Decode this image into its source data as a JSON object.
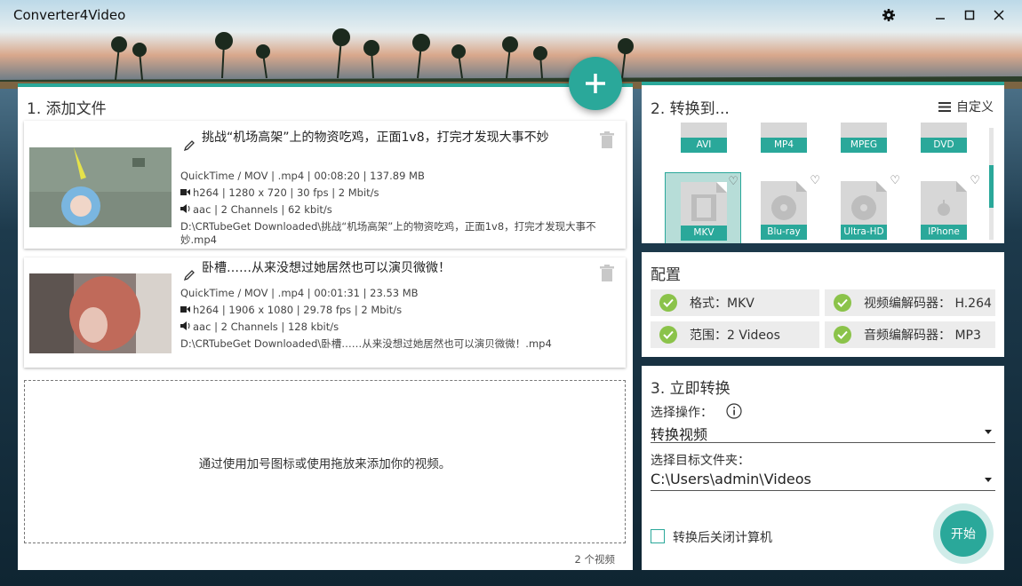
{
  "app": {
    "title": "Converter4Video"
  },
  "left": {
    "title": "1. 添加文件",
    "files": [
      {
        "name": "挑战“机场高架”上的物资吃鸡，正面1v8，打完才发现大事不妙",
        "container": "QuickTime / MOV | .mp4 | 00:08:20 | 137.89 MB",
        "video": "h264 | 1280 x 720 | 30 fps | 2 Mbit/s",
        "audio": "aac | 2 Channels | 62 kbit/s",
        "path": "D:\\CRTubeGet Downloaded\\挑战“机场高架”上的物资吃鸡，正面1v8，打完才发现大事不妙.mp4"
      },
      {
        "name": "卧槽……从来没想过她居然也可以演贝微微！",
        "container": "QuickTime / MOV | .mp4 | 00:01:31 | 23.53 MB",
        "video": "h264 | 1906 x 1080 | 29.78 fps | 2 Mbit/s",
        "audio": "aac | 2 Channels | 128 kbit/s",
        "path": "D:\\CRTubeGet Downloaded\\卧槽……从来没想过她居然也可以演贝微微！.mp4"
      }
    ],
    "dropzone_text": "通过使用加号图标或使用拖放来添加你的视频。",
    "count": "2 个视频"
  },
  "formats": {
    "title": "2. 转换到...",
    "customize": "自定义",
    "row1": [
      "AVI",
      "MP4",
      "MPEG",
      "DVD"
    ],
    "row2": [
      "MKV",
      "Blu-ray",
      "Ultra-HD",
      "IPhone"
    ],
    "selected": "MKV"
  },
  "config": {
    "title": "配置",
    "format": "格式：MKV",
    "video_codec": "视频编解码器：  H.264",
    "range": "范围：2 Videos",
    "audio_codec": "音频编解码器：  MP3"
  },
  "convert": {
    "title": "3. 立即转换",
    "op_label": "选择操作：",
    "op_value": "转换视频",
    "folder_label": "选择目标文件夹：",
    "folder_value": "C:\\Users\\admin\\Videos",
    "shutdown_label": "转换后关闭计算机",
    "start": "开始"
  },
  "colors": {
    "accent": "#2aa89a",
    "check": "#8bc34a"
  }
}
